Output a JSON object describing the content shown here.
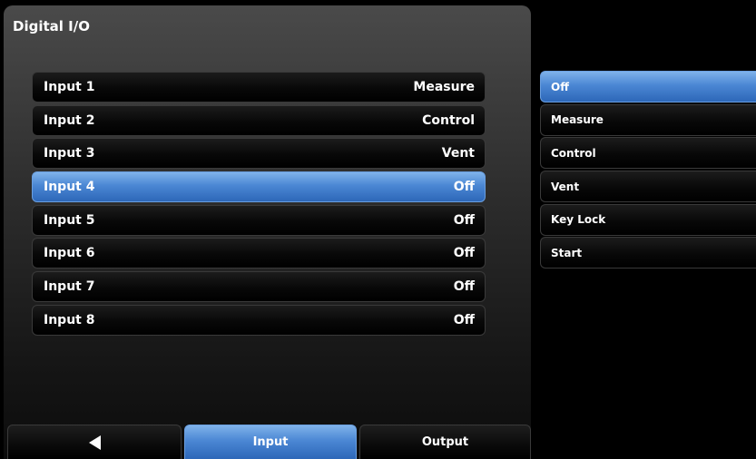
{
  "title": "Digital I/O",
  "inputs": [
    {
      "label": "Input 1",
      "value": "Measure",
      "selected": false
    },
    {
      "label": "Input 2",
      "value": "Control",
      "selected": false
    },
    {
      "label": "Input 3",
      "value": "Vent",
      "selected": false
    },
    {
      "label": "Input 4",
      "value": "Off",
      "selected": true
    },
    {
      "label": "Input 5",
      "value": "Off",
      "selected": false
    },
    {
      "label": "Input 6",
      "value": "Off",
      "selected": false
    },
    {
      "label": "Input 7",
      "value": "Off",
      "selected": false
    },
    {
      "label": "Input 8",
      "value": "Off",
      "selected": false
    }
  ],
  "options": [
    {
      "label": "Off",
      "selected": true
    },
    {
      "label": "Measure",
      "selected": false
    },
    {
      "label": "Control",
      "selected": false
    },
    {
      "label": "Vent",
      "selected": false
    },
    {
      "label": "Key Lock",
      "selected": false
    },
    {
      "label": "Start",
      "selected": false
    }
  ],
  "tabs": {
    "back_icon": "left-triangle-icon",
    "input_label": "Input",
    "output_label": "Output",
    "active": "input"
  },
  "colors": {
    "selected_accent": "#4b87d4"
  }
}
